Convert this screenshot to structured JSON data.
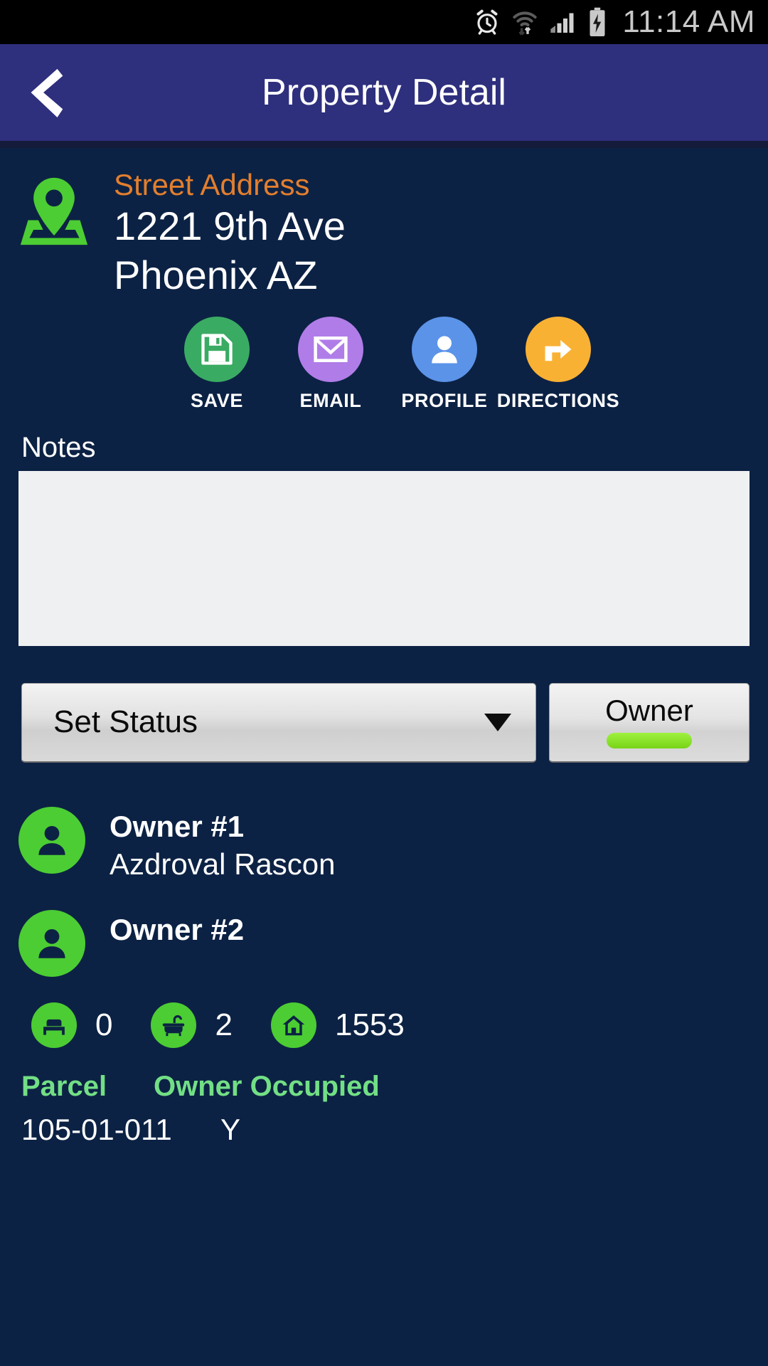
{
  "status_bar": {
    "time": "11:14 AM",
    "icons": [
      "alarm-icon",
      "wifi-icon",
      "cellular-signal-icon",
      "battery-charging-icon"
    ]
  },
  "title_bar": {
    "back_icon": "chevron-left-icon",
    "title": "Property Detail",
    "bg_color": "#2e2f7d"
  },
  "address": {
    "pin_icon": "map-pin-icon",
    "label": "Street Address",
    "line1": "1221 9th Ave",
    "line2": "Phoenix AZ",
    "label_color": "#e37f2e"
  },
  "actions": [
    {
      "label": "SAVE",
      "icon": "floppy-disk-icon",
      "color": "#3aab63"
    },
    {
      "label": "EMAIL",
      "icon": "envelope-icon",
      "color": "#b07de8"
    },
    {
      "label": "PROFILE",
      "icon": "person-icon",
      "color": "#5b93e8"
    },
    {
      "label": "DIRECTIONS",
      "icon": "turn-right-arrow-icon",
      "color": "#f9b134"
    }
  ],
  "notes": {
    "label": "Notes",
    "value": "",
    "placeholder": ""
  },
  "status_control": {
    "selected": "Set Status",
    "caret_icon": "chevron-down-icon"
  },
  "owner_toggle": {
    "label": "Owner",
    "indicator_color": "#8ade22"
  },
  "owners": [
    {
      "title": "Owner #1",
      "name": "Azdroval Rascon",
      "avatar_icon": "person-avatar-icon"
    },
    {
      "title": "Owner #2",
      "name": "",
      "avatar_icon": "person-avatar-icon"
    }
  ],
  "stats": [
    {
      "icon": "bed-icon",
      "value": "0"
    },
    {
      "icon": "bathtub-icon",
      "value": "2"
    },
    {
      "icon": "house-icon",
      "value": "1553"
    }
  ],
  "parcel": {
    "parcel_label": "Parcel",
    "parcel_value": "105-01-011",
    "owner_occupied_label": "Owner Occupied",
    "owner_occupied_value": "Y",
    "label_color": "#72df85"
  },
  "theme": {
    "background": "#0c2244",
    "accent_green": "#4ccd33",
    "accent_orange": "#e37f2e"
  }
}
